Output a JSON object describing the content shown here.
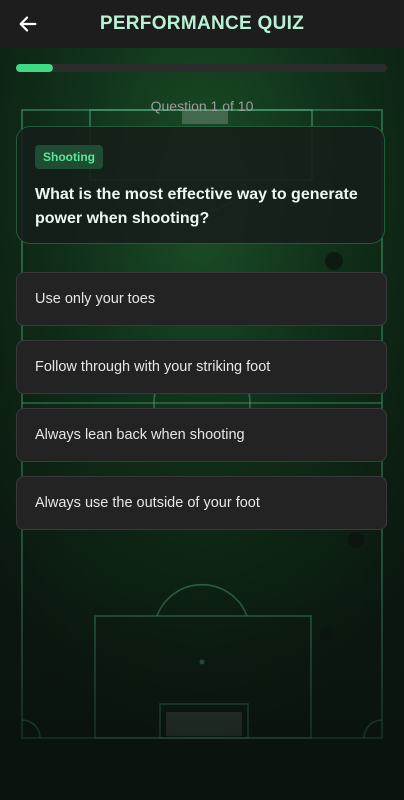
{
  "header": {
    "title": "PERFORMANCE QUIZ",
    "back_icon": "arrow-left-icon"
  },
  "progress": {
    "fraction": 0.1,
    "color": "#3ddc84"
  },
  "counter_text": "Question 1 of 10",
  "question": {
    "category": "Shooting",
    "text": "What is the most effective way to generate power when shooting?"
  },
  "options": [
    {
      "label": "Use only your toes"
    },
    {
      "label": "Follow through with your striking foot"
    },
    {
      "label": "Always lean back when shooting"
    },
    {
      "label": "Always use the outside of your foot"
    }
  ],
  "colors": {
    "accent": "#3ddc84",
    "title": "#b9f2d3",
    "card_bg": "#232323"
  }
}
